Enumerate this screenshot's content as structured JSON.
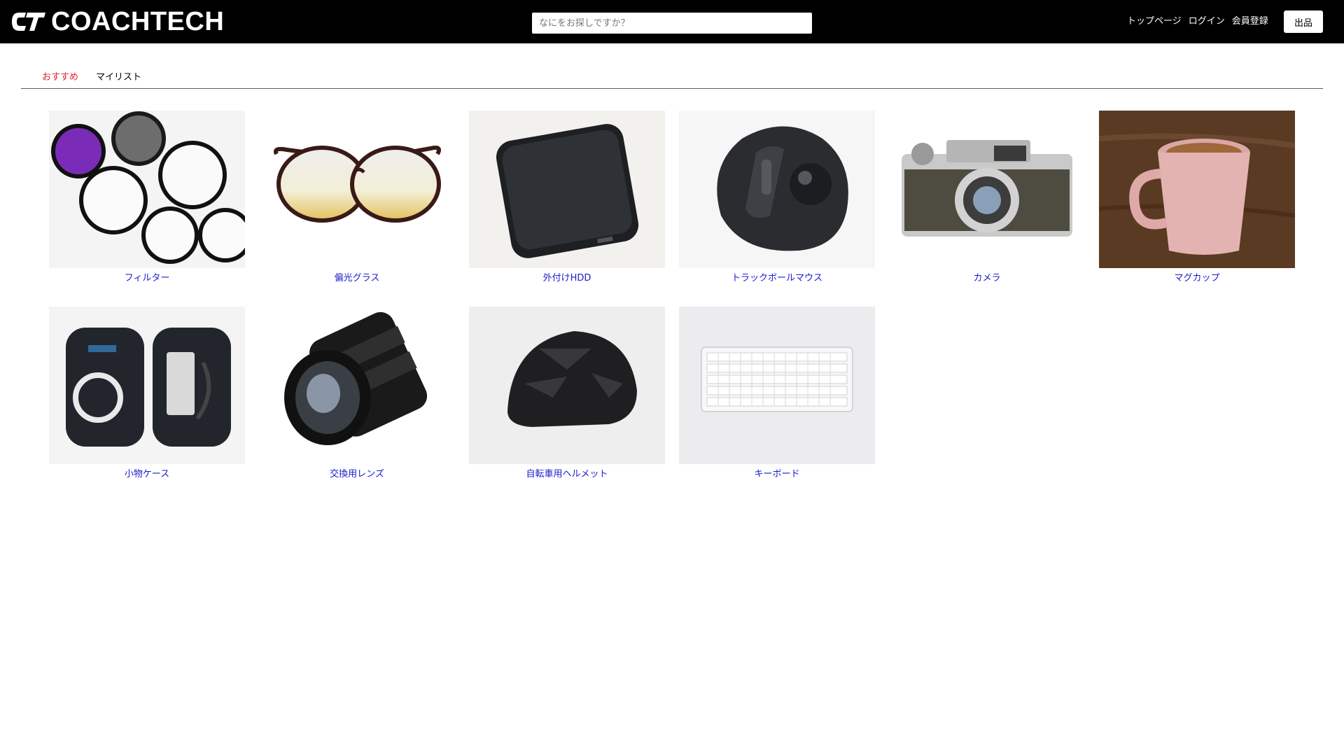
{
  "header": {
    "logo_text": "COACHTECH",
    "search_placeholder": "なにをお探しですか？",
    "nav": {
      "top_label": "トップページ",
      "login_label": "ログイン",
      "register_label": "会員登録"
    },
    "sell_label": "出品"
  },
  "tabs": {
    "recommended_label": "おすすめ",
    "mylist_label": "マイリスト"
  },
  "items": [
    {
      "name": "フィルター",
      "icon": "filters-photo"
    },
    {
      "name": "偏光グラス",
      "icon": "glasses-photo"
    },
    {
      "name": "外付けHDD",
      "icon": "hdd-photo"
    },
    {
      "name": "トラックボールマウス",
      "icon": "trackball-mouse-photo"
    },
    {
      "name": "カメラ",
      "icon": "camera-photo"
    },
    {
      "name": "マグカップ",
      "icon": "mug-photo"
    },
    {
      "name": "小物ケース",
      "icon": "pouch-photo"
    },
    {
      "name": "交換用レンズ",
      "icon": "lens-photo"
    },
    {
      "name": "自転車用ヘルメット",
      "icon": "helmet-photo"
    },
    {
      "name": "キーボード",
      "icon": "keyboard-photo"
    }
  ],
  "colors": {
    "header_bg": "#000000",
    "active_tab": "#e0202a",
    "item_label": "#1a1acc"
  }
}
